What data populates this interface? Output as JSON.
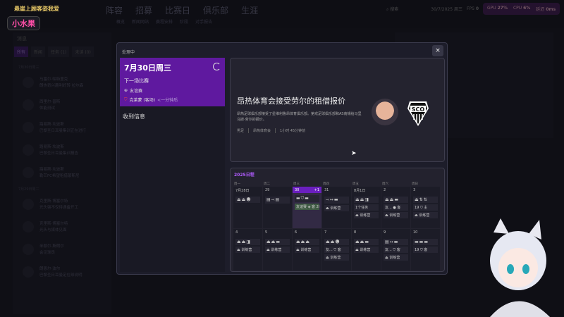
{
  "streamer": {
    "banner": "悬崖上顾客姿我爱",
    "name": "小水果"
  },
  "topnav": {
    "items": [
      "阵容",
      "招募",
      "比赛日",
      "俱乐部",
      "生涯"
    ],
    "subnav": [
      "概览",
      "新闻网站",
      "赛程安排",
      "阶段",
      "对手报告"
    ],
    "search": "搜索",
    "date": "30/7/2025",
    "weekday": "周三"
  },
  "perf": {
    "fps_label": "FPS",
    "fps": "0",
    "gpu_label": "GPU",
    "gpu": "27%",
    "cpu_label": "CPU",
    "cpu": "6%",
    "latency_label": "延迟",
    "latency": "0ms"
  },
  "inbox": {
    "title": "消息",
    "tabs": [
      "所有",
      "新闻",
      "任务 (1)",
      "未读 (0)"
    ],
    "groups": [
      {
        "label": "7月30日周三",
        "items": [
          {
            "from": "马塞尔·帕特里克",
            "text": "朗热奇兴趣利好转 拉尔森"
          },
          {
            "from": "西里尔·普斯",
            "text": "体能测试"
          },
          {
            "from": "路易斯·坎波斯",
            "text": "巴黎圣日耳曼集训正在进行"
          },
          {
            "from": "路易斯·坎波斯",
            "text": "巴黎圣日耳曼集训报告"
          },
          {
            "from": "路易斯·坎波斯",
            "text": "勒芒FC希望租借蒙斯尼"
          }
        ]
      },
      {
        "label": "7月29日周二",
        "items": [
          {
            "from": "克里斯·博塞尔特",
            "text": "光头强不仅待遇备开工"
          },
          {
            "from": "克里斯·博塞尔特",
            "text": "光头与媒体见面"
          },
          {
            "from": "米歇尔·斯朗尔",
            "text": "会见球员"
          },
          {
            "from": "朗恩尔·波尔",
            "text": "巴黎圣日耳曼定位球说明"
          }
        ]
      }
    ]
  },
  "modal": {
    "title": "处理中",
    "close": "×",
    "next": {
      "date": "7月30日周三",
      "label": "下一场比赛",
      "competition": "友谊赛",
      "opponent": "克莱蒙 (客场)",
      "when": "<一分钟后"
    },
    "received": "收到信息",
    "article": {
      "headline": "昂热体育会接受劳尔的租借报价",
      "body": "昂热足球俱乐部接受了星维利鲁昂体育俱乐部。第戎足球俱乐部和AS南锡给马里乌斯·劳尔的报价。",
      "tags": [
        "男足",
        "昂热体育会",
        "1小时 45分钟前"
      ],
      "crest_text": "SCO"
    },
    "calendar": {
      "title": "2025日程",
      "days": [
        "周一",
        "周二",
        "周三",
        "周四",
        "周五",
        "周六",
        "周日"
      ],
      "cells": [
        {
          "date": "7月28日",
          "icons": "⏏⏏☻",
          "events": []
        },
        {
          "date": "29",
          "icons": "▤⤙▤",
          "events": []
        },
        {
          "date": "30",
          "extra": "+1",
          "today": true,
          "icons": "▬⛉▬",
          "events": [
            {
              "text": "友谊赛 ◈ 客 20:00",
              "type": "match"
            }
          ]
        },
        {
          "date": "31",
          "icons": "⤙↔▬",
          "events": [
            {
              "text": "⏏ 训练营"
            }
          ]
        },
        {
          "date": "8月1日",
          "icons": "⏏⏏◨",
          "events": [
            {
              "text": "1个任务",
              "type": "task"
            },
            {
              "text": "⏏ 训练营"
            }
          ]
        },
        {
          "date": "2",
          "icons": "⏏⏏▬",
          "events": [
            {
              "text": "友... ● 客"
            },
            {
              "text": "⏏ 训练营"
            }
          ]
        },
        {
          "date": "3",
          "icons": "⏏⇅⇅",
          "events": [
            {
              "text": "19 ⛉ 主"
            },
            {
              "text": "⏏ 训练营"
            }
          ]
        },
        {
          "date": "4",
          "icons": "⏏⏏◨",
          "events": [
            {
              "text": "⏏ 训练营"
            }
          ]
        },
        {
          "date": "5",
          "icons": "⏏⏏▬",
          "events": [
            {
              "text": "⏏ 训练营"
            }
          ]
        },
        {
          "date": "6",
          "icons": "⏏⏏⏏",
          "events": [
            {
              "text": "⏏ 训练营"
            }
          ]
        },
        {
          "date": "7",
          "icons": "⏏⏏☻",
          "events": [
            {
              "text": "友... ⛉ 客"
            },
            {
              "text": "⏏ 训练营"
            }
          ]
        },
        {
          "date": "8",
          "icons": "⏏⏏▬",
          "events": [
            {
              "text": "⏏ 训练营"
            }
          ]
        },
        {
          "date": "9",
          "icons": "▤↔▬",
          "events": [
            {
              "text": "友... ⛉ 客"
            },
            {
              "text": "⏏ 训练营"
            }
          ]
        },
        {
          "date": "10",
          "icons": "▬▬▬",
          "events": [
            {
              "text": "19 ⛉ 客"
            }
          ]
        }
      ]
    }
  }
}
